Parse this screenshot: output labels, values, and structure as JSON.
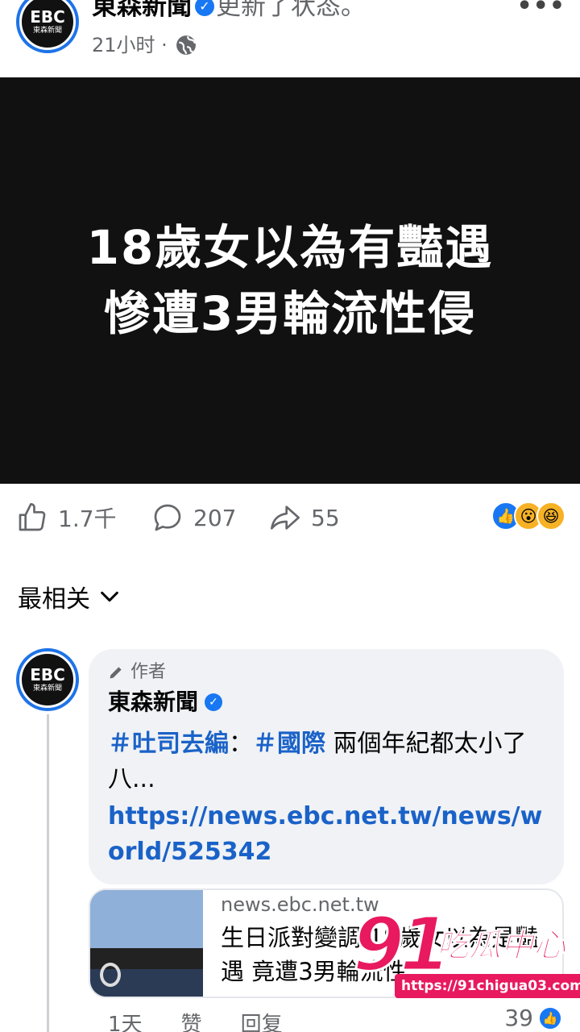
{
  "header": {
    "logo_text": "EBC",
    "logo_sub": "東森新聞",
    "page_name": "東森新聞",
    "status": "更新了状态。",
    "time": "21小时 ·"
  },
  "image": {
    "headline_line1": "18歲女以為有豔遇",
    "headline_line2": "慘遭3男輪流性侵"
  },
  "actions": {
    "likes": "1.7千",
    "comments": "207",
    "shares": "55"
  },
  "sort": {
    "label": "最相关"
  },
  "comment": {
    "author_tag": "作者",
    "name": "東森新聞",
    "hashtag1": "＃吐司去編",
    "sep": "：",
    "hashtag2": "＃國際",
    "text": " 兩個年紀都太小了八...",
    "link": "https://news.ebc.net.tw/news/world/525342",
    "card_domain": "news.ebc.net.tw",
    "card_title": "生日派對變調 18歲女以為是豔遇 竟遭3男輪流性",
    "time": "1天",
    "like_label": "赞",
    "reply_label": "回复",
    "reaction_count": "39"
  },
  "watermark": {
    "number": "91",
    "name": "吃瓜中心",
    "url": "https://91chigua03.com"
  },
  "colors": {
    "accent": "#1877f2",
    "hashtag": "#1a62c8",
    "watermark": "#e8195e"
  }
}
